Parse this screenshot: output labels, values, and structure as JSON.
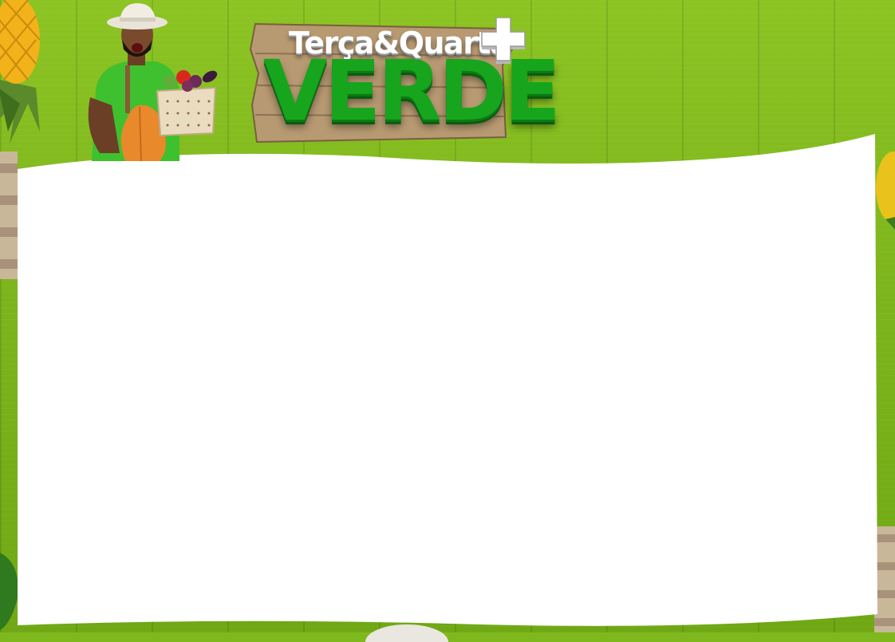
{
  "logo": {
    "line1": "Terça&Quarta",
    "line2": "VERDE",
    "plus_icon": "plus-icon"
  },
  "colors": {
    "background_green": "#7fb81c",
    "logo_green": "#17a51d",
    "paper": "#ffffff"
  }
}
